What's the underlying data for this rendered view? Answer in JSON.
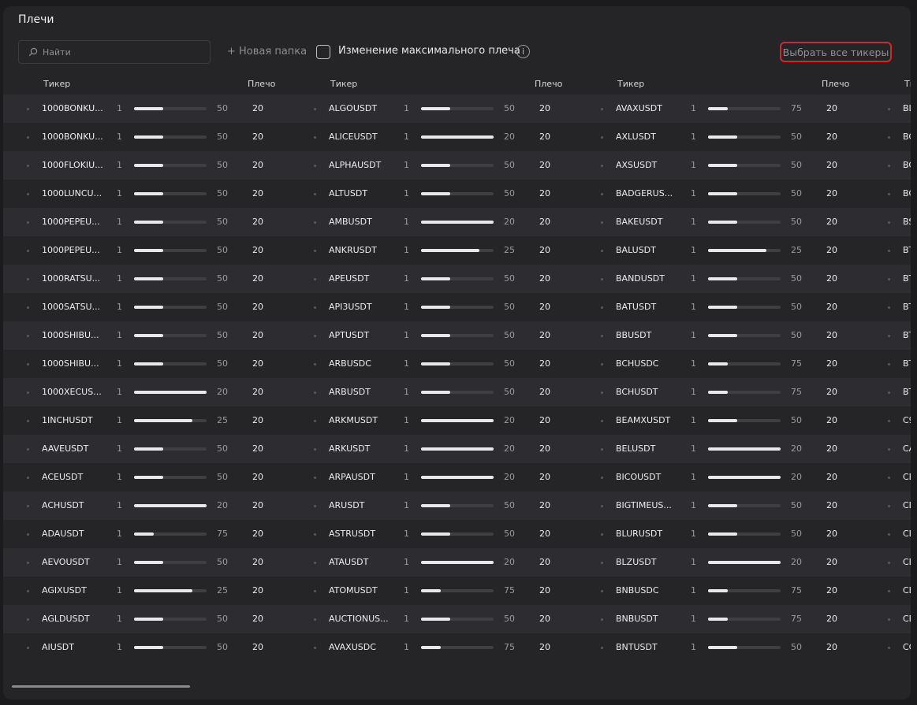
{
  "title": "Плечи",
  "search": {
    "placeholder": "Найти"
  },
  "new_folder_label": "+ Новая папка",
  "max_leverage_label": "Изменение максимального плеча",
  "info_icon_glyph": "i",
  "select_all_label": "Выбрать все тикеры",
  "headers": {
    "ticker": "Тикер",
    "leverage": "Плечо"
  },
  "columns": [
    [
      {
        "t": "1000BONKU...",
        "min": "1",
        "max": "50",
        "value": 20,
        "lev": "20"
      },
      {
        "t": "1000BONKU...",
        "min": "1",
        "max": "50",
        "value": 20,
        "lev": "20"
      },
      {
        "t": "1000FLOKIU...",
        "min": "1",
        "max": "50",
        "value": 20,
        "lev": "20"
      },
      {
        "t": "1000LUNCU...",
        "min": "1",
        "max": "50",
        "value": 20,
        "lev": "20"
      },
      {
        "t": "1000PEPEU...",
        "min": "1",
        "max": "50",
        "value": 20,
        "lev": "20"
      },
      {
        "t": "1000PEPEU...",
        "min": "1",
        "max": "50",
        "value": 20,
        "lev": "20"
      },
      {
        "t": "1000RATSU...",
        "min": "1",
        "max": "50",
        "value": 20,
        "lev": "20"
      },
      {
        "t": "1000SATSU...",
        "min": "1",
        "max": "50",
        "value": 20,
        "lev": "20"
      },
      {
        "t": "1000SHIBU...",
        "min": "1",
        "max": "50",
        "value": 20,
        "lev": "20"
      },
      {
        "t": "1000SHIBU...",
        "min": "1",
        "max": "50",
        "value": 20,
        "lev": "20"
      },
      {
        "t": "1000XECUS...",
        "min": "1",
        "max": "20",
        "value": 20,
        "lev": "20"
      },
      {
        "t": "1INCHUSDT",
        "min": "1",
        "max": "25",
        "value": 20,
        "lev": "20"
      },
      {
        "t": "AAVEUSDT",
        "min": "1",
        "max": "50",
        "value": 20,
        "lev": "20"
      },
      {
        "t": "ACEUSDT",
        "min": "1",
        "max": "50",
        "value": 20,
        "lev": "20"
      },
      {
        "t": "ACHUSDT",
        "min": "1",
        "max": "20",
        "value": 20,
        "lev": "20"
      },
      {
        "t": "ADAUSDT",
        "min": "1",
        "max": "75",
        "value": 20,
        "lev": "20"
      },
      {
        "t": "AEVOUSDT",
        "min": "1",
        "max": "50",
        "value": 20,
        "lev": "20"
      },
      {
        "t": "AGIXUSDT",
        "min": "1",
        "max": "25",
        "value": 20,
        "lev": "20"
      },
      {
        "t": "AGLDUSDT",
        "min": "1",
        "max": "50",
        "value": 20,
        "lev": "20"
      },
      {
        "t": "AIUSDT",
        "min": "1",
        "max": "50",
        "value": 20,
        "lev": "20"
      }
    ],
    [
      {
        "t": "ALGOUSDT",
        "min": "1",
        "max": "50",
        "value": 20,
        "lev": "20"
      },
      {
        "t": "ALICEUSDT",
        "min": "1",
        "max": "20",
        "value": 20,
        "lev": "20"
      },
      {
        "t": "ALPHAUSDT",
        "min": "1",
        "max": "50",
        "value": 20,
        "lev": "20"
      },
      {
        "t": "ALTUSDT",
        "min": "1",
        "max": "50",
        "value": 20,
        "lev": "20"
      },
      {
        "t": "AMBUSDT",
        "min": "1",
        "max": "20",
        "value": 20,
        "lev": "20"
      },
      {
        "t": "ANKRUSDT",
        "min": "1",
        "max": "25",
        "value": 20,
        "lev": "20"
      },
      {
        "t": "APEUSDT",
        "min": "1",
        "max": "50",
        "value": 20,
        "lev": "20"
      },
      {
        "t": "API3USDT",
        "min": "1",
        "max": "50",
        "value": 20,
        "lev": "20"
      },
      {
        "t": "APTUSDT",
        "min": "1",
        "max": "50",
        "value": 20,
        "lev": "20"
      },
      {
        "t": "ARBUSDC",
        "min": "1",
        "max": "50",
        "value": 20,
        "lev": "20"
      },
      {
        "t": "ARBUSDT",
        "min": "1",
        "max": "50",
        "value": 20,
        "lev": "20"
      },
      {
        "t": "ARKMUSDT",
        "min": "1",
        "max": "20",
        "value": 20,
        "lev": "20"
      },
      {
        "t": "ARKUSDT",
        "min": "1",
        "max": "20",
        "value": 20,
        "lev": "20"
      },
      {
        "t": "ARPAUSDT",
        "min": "1",
        "max": "20",
        "value": 20,
        "lev": "20"
      },
      {
        "t": "ARUSDT",
        "min": "1",
        "max": "50",
        "value": 20,
        "lev": "20"
      },
      {
        "t": "ASTRUSDT",
        "min": "1",
        "max": "50",
        "value": 20,
        "lev": "20"
      },
      {
        "t": "ATAUSDT",
        "min": "1",
        "max": "20",
        "value": 20,
        "lev": "20"
      },
      {
        "t": "ATOMUSDT",
        "min": "1",
        "max": "75",
        "value": 20,
        "lev": "20"
      },
      {
        "t": "AUCTIONUS...",
        "min": "1",
        "max": "50",
        "value": 20,
        "lev": "20"
      },
      {
        "t": "AVAXUSDC",
        "min": "1",
        "max": "75",
        "value": 20,
        "lev": "20"
      }
    ],
    [
      {
        "t": "AVAXUSDT",
        "min": "1",
        "max": "75",
        "value": 20,
        "lev": "20"
      },
      {
        "t": "AXLUSDT",
        "min": "1",
        "max": "50",
        "value": 20,
        "lev": "20"
      },
      {
        "t": "AXSUSDT",
        "min": "1",
        "max": "50",
        "value": 20,
        "lev": "20"
      },
      {
        "t": "BADGERUS...",
        "min": "1",
        "max": "50",
        "value": 20,
        "lev": "20"
      },
      {
        "t": "BAKEUSDT",
        "min": "1",
        "max": "50",
        "value": 20,
        "lev": "20"
      },
      {
        "t": "BALUSDT",
        "min": "1",
        "max": "25",
        "value": 20,
        "lev": "20"
      },
      {
        "t": "BANDUSDT",
        "min": "1",
        "max": "50",
        "value": 20,
        "lev": "20"
      },
      {
        "t": "BATUSDT",
        "min": "1",
        "max": "50",
        "value": 20,
        "lev": "20"
      },
      {
        "t": "BBUSDT",
        "min": "1",
        "max": "50",
        "value": 20,
        "lev": "20"
      },
      {
        "t": "BCHUSDC",
        "min": "1",
        "max": "75",
        "value": 20,
        "lev": "20"
      },
      {
        "t": "BCHUSDT",
        "min": "1",
        "max": "75",
        "value": 20,
        "lev": "20"
      },
      {
        "t": "BEAMXUSDT",
        "min": "1",
        "max": "50",
        "value": 20,
        "lev": "20"
      },
      {
        "t": "BELUSDT",
        "min": "1",
        "max": "20",
        "value": 20,
        "lev": "20"
      },
      {
        "t": "BICOUSDT",
        "min": "1",
        "max": "20",
        "value": 20,
        "lev": "20"
      },
      {
        "t": "BIGTIMEUS...",
        "min": "1",
        "max": "50",
        "value": 20,
        "lev": "20"
      },
      {
        "t": "BLURUSDT",
        "min": "1",
        "max": "50",
        "value": 20,
        "lev": "20"
      },
      {
        "t": "BLZUSDT",
        "min": "1",
        "max": "20",
        "value": 20,
        "lev": "20"
      },
      {
        "t": "BNBUSDC",
        "min": "1",
        "max": "75",
        "value": 20,
        "lev": "20"
      },
      {
        "t": "BNBUSDT",
        "min": "1",
        "max": "75",
        "value": 20,
        "lev": "20"
      },
      {
        "t": "BNTUSDT",
        "min": "1",
        "max": "50",
        "value": 20,
        "lev": "20"
      }
    ],
    [
      {
        "t": "BL"
      },
      {
        "t": "BC"
      },
      {
        "t": "BC"
      },
      {
        "t": "BC"
      },
      {
        "t": "BS"
      },
      {
        "t": "BT"
      },
      {
        "t": "BT"
      },
      {
        "t": "BT"
      },
      {
        "t": "BT"
      },
      {
        "t": "BT"
      },
      {
        "t": "BT"
      },
      {
        "t": "C9"
      },
      {
        "t": "CA"
      },
      {
        "t": "CE"
      },
      {
        "t": "CE"
      },
      {
        "t": "CE"
      },
      {
        "t": "CE"
      },
      {
        "t": "CE"
      },
      {
        "t": "CE"
      },
      {
        "t": "CC"
      }
    ]
  ]
}
